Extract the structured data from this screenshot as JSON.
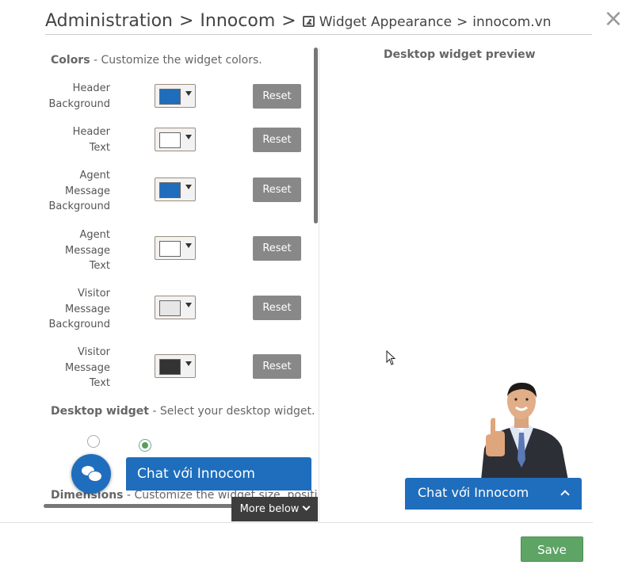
{
  "header": {
    "crumb1": "Administration",
    "sep1": ">",
    "crumb2": "Innocom",
    "sep2": ">",
    "crumb3": "Widget Appearance",
    "sep3": ">",
    "crumb4": "innocom.vn",
    "close_glyph": "×"
  },
  "colors_section": {
    "title": "Colors",
    "subtitle": "- Customize the widget colors.",
    "rows": [
      {
        "label": [
          "Header",
          "Background"
        ],
        "color": "#1f6ebd",
        "reset": "Reset"
      },
      {
        "label": [
          "Header",
          "Text"
        ],
        "color": "#ffffff",
        "reset": "Reset"
      },
      {
        "label": [
          "Agent",
          "Message",
          "Background"
        ],
        "color": "#1f6ebd",
        "reset": "Reset"
      },
      {
        "label": [
          "Agent",
          "Message",
          "Text"
        ],
        "color": "#ffffff",
        "reset": "Reset"
      },
      {
        "label": [
          "Visitor",
          "Message",
          "Background"
        ],
        "color": "#e6e6e6",
        "reset": "Reset"
      },
      {
        "label": [
          "Visitor",
          "Message",
          "Text"
        ],
        "color": "#333333",
        "reset": "Reset"
      }
    ]
  },
  "desktop_widget": {
    "title": "Desktop widget",
    "subtitle": "- Select your desktop widget.",
    "options": [
      {
        "type": "bubble",
        "selected": false,
        "icon": "chat-bubbles-icon"
      },
      {
        "type": "bar",
        "selected": true,
        "label": "Chat với Innocom"
      }
    ]
  },
  "dimensions": {
    "title": "Dimensions",
    "subtitle": "- Customize the widget size, position"
  },
  "more_below": "More below",
  "preview": {
    "title": "Desktop widget preview",
    "bar_label": "Chat với Innocom"
  },
  "save_label": "Save",
  "colors": {
    "accent": "#1f6ebd",
    "save": "#5ea465",
    "reset": "#888888"
  }
}
